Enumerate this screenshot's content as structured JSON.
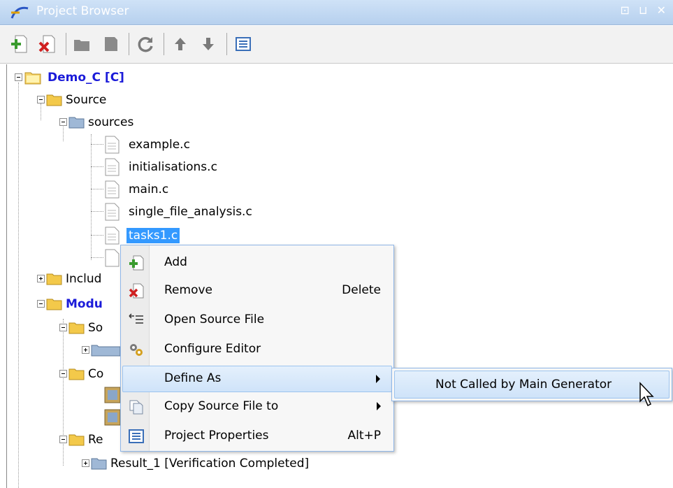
{
  "window": {
    "title": "Project Browser",
    "controls": "⊡ ⊔ ✕"
  },
  "toolbar": {
    "buttons": [
      "add-file-icon",
      "remove-file-icon",
      "open-folder-icon",
      "document-icon",
      "refresh-icon",
      "arrow-up-icon",
      "arrow-down-icon",
      "properties-icon"
    ]
  },
  "tree": {
    "root": "Demo_C [C]",
    "source": "Source",
    "sources": "sources",
    "files": [
      "example.c",
      "initialisations.c",
      "main.c",
      "single_file_analysis.c",
      "tasks1.c"
    ],
    "includes_partial": "Includ",
    "modules_partial": "Modu",
    "mod_source_partial": "So",
    "mod_config_partial": "Co",
    "mod_results_partial": "Re",
    "result_1": "Result_1 [Verification Completed]"
  },
  "context_menu": {
    "items": [
      {
        "label": "Add",
        "shortcut": "",
        "icon": "add-icon"
      },
      {
        "label": "Remove",
        "shortcut": "Delete",
        "icon": "remove-icon"
      },
      {
        "label": "Open Source File",
        "shortcut": "",
        "icon": "open-source-icon"
      },
      {
        "label": "Configure Editor",
        "shortcut": "",
        "icon": "gears-icon"
      },
      {
        "label": "Define As",
        "shortcut": "",
        "icon": ""
      },
      {
        "label": "Copy Source File to",
        "shortcut": "",
        "icon": "copy-icon"
      },
      {
        "label": "Project Properties",
        "shortcut": "Alt+P",
        "icon": "properties-icon"
      }
    ]
  },
  "submenu": {
    "item": "Not Called by Main Generator"
  }
}
